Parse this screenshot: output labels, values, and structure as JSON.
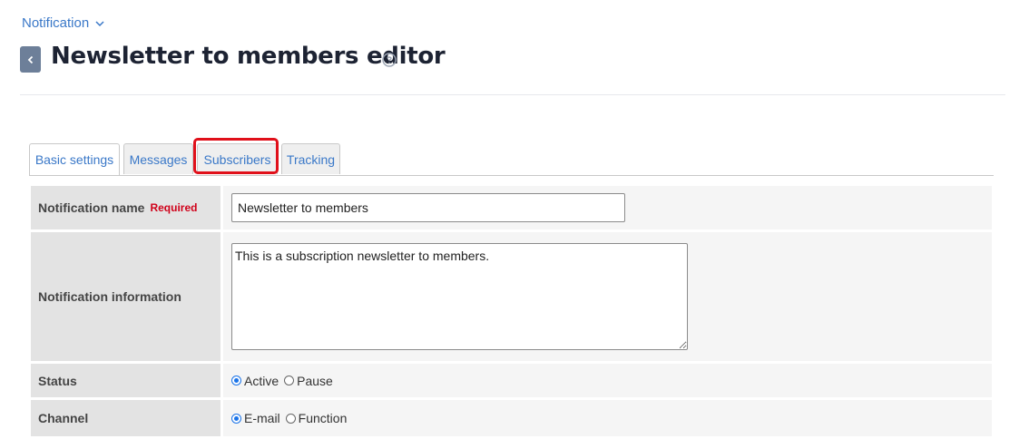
{
  "breadcrumb": {
    "label": "Notification"
  },
  "header": {
    "title": "Newsletter to members editor"
  },
  "tabs": [
    {
      "label": "Basic settings",
      "active": true
    },
    {
      "label": "Messages",
      "active": false
    },
    {
      "label": "Subscribers",
      "active": false,
      "highlighted": true
    },
    {
      "label": "Tracking",
      "active": false
    }
  ],
  "form": {
    "notification_name": {
      "label": "Notification name",
      "required_label": "Required",
      "value": "Newsletter to members"
    },
    "notification_information": {
      "label": "Notification information",
      "value": "This is a subscription newsletter to members."
    },
    "status": {
      "label": "Status",
      "options": [
        "Active",
        "Pause"
      ],
      "selected": "Active"
    },
    "channel": {
      "label": "Channel",
      "options": [
        "E-mail",
        "Function"
      ],
      "selected": "E-mail"
    }
  },
  "colors": {
    "link": "#3a78c8",
    "highlight": "#e0101a",
    "required": "#d0021b",
    "back_button": "#6d7f99"
  }
}
